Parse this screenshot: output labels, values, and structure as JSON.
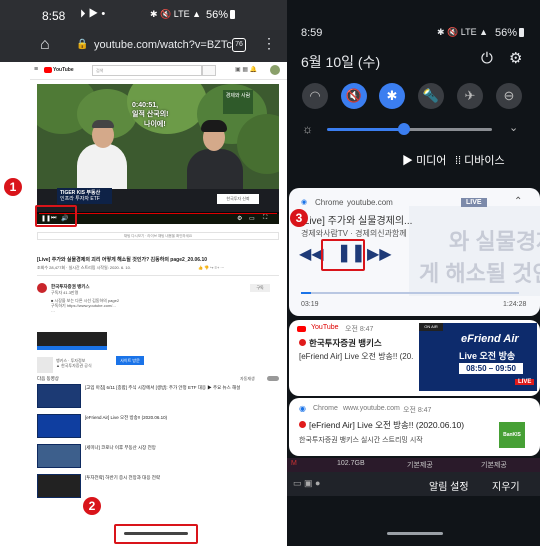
{
  "left": {
    "status_time": "8:58",
    "status_battery": "56%",
    "status_network": "LTE",
    "url": "youtube.com/watch?v=BZTc",
    "tab_count": "76",
    "yt_search_placeholder": "검색",
    "video_overlay_text_1": "0:40:51,",
    "video_overlay_text_2": "일적 산국의!",
    "video_overlay_text_3": "나이에!",
    "video_brand_top": "경제와 사람",
    "video_caption_left": "TIGER KIS 부동산",
    "video_caption_left_2": "인프라 투자자 ETF",
    "video_caption_right": "한국투자 신뢰",
    "video_title": "[Live] 주가와 실물경제의 괴리 어떻게 해소될 것인가? 김동하의 page2_20.06.10",
    "video_meta": "조회수 28,477회 · 실시간 스트리밍 시작일: 2020. 6. 10.",
    "channel_name": "한국투자증권 뱅키스",
    "subscribe_label": "구독",
    "up_next_label": "다음 동영상",
    "autoplay_label": "자동재생",
    "up_next": [
      {
        "title": "[고입 아침] 6/11 [종합] 주식 시장에서 [생방]: 주가 안정 ETF 대응 ▶ 주요 뉴스 해설"
      },
      {
        "title": "[eFriend Air] Live 오전 방송!! (2020.06.10)"
      },
      {
        "title": "[세미나] 코로나 이후 부동산 시장 전망"
      },
      {
        "title": "[투자전략] 하반기 증시 전망과 대응 전략"
      }
    ]
  },
  "right": {
    "status_time": "8:59",
    "status_battery": "56%",
    "date": "6월 10일 (수)",
    "media_label": "미디어",
    "devices_label": "디바이스",
    "media_player": {
      "source": "Chrome",
      "domain": "youtube.com",
      "title": "[Live] 주가와 실물경제의...",
      "subtitle": "경제와사람TV · 경제의신과함께",
      "time_current": "03:19",
      "time_total": "1:24:28",
      "live_badge": "LIVE",
      "watermark_1": "와 실물경제의 괴",
      "watermark_2": "게 해소될 것인가"
    },
    "notification_1": {
      "app": "YouTube",
      "time": "오전 8:47",
      "title": "한국투자증권 뱅키스",
      "body": "[eFriend Air] Live 오전 방송!! (20...",
      "thumb_title": "eFriend Air",
      "thumb_sub": "Live 오전 방송",
      "thumb_time": "08:50 – 09:50",
      "live_badge": "LIVE"
    },
    "notification_2": {
      "app": "Chrome",
      "domain": "www.youtube.com",
      "time": "오전 8:47",
      "title": "[eFriend Air] Live 오전 방송!! (2020.06.10)",
      "body": "한국투자증권 뱅키스 실시간 스트리밍 시작"
    },
    "bottom_stat_1": "102.7GB",
    "bottom_stat_2": "기본제공",
    "bottom_stat_3": "기본제공",
    "notif_settings_label": "알림 설정",
    "clear_label": "지우기"
  },
  "annotations": [
    "1",
    "2",
    "3"
  ]
}
